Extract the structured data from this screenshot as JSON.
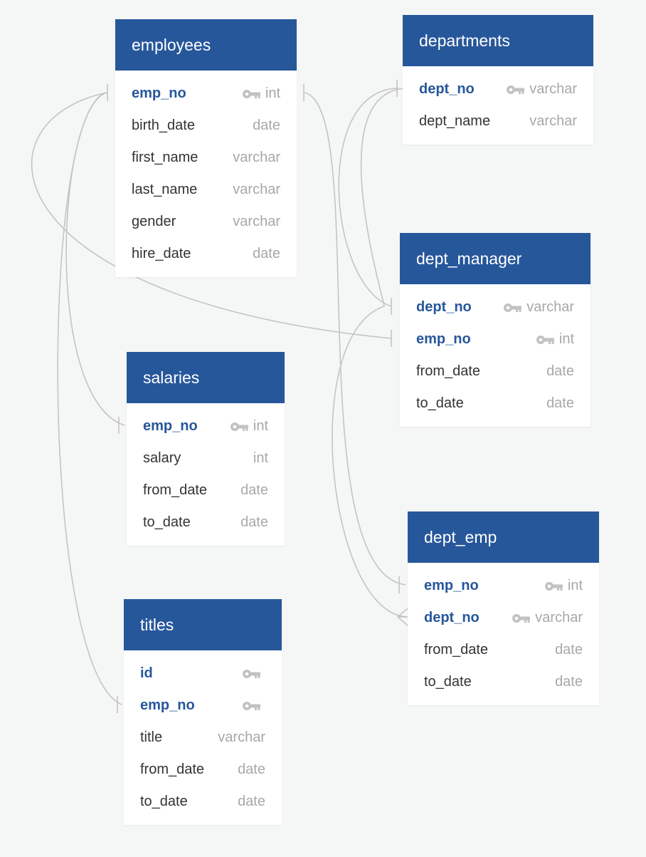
{
  "colors": {
    "header": "#27579b",
    "pk_text": "#27579b",
    "text": "#333333",
    "type_text": "#a8a8a8",
    "connector": "#c4c4c4",
    "background": "#f5f6f6"
  },
  "tables": [
    {
      "id": "employees",
      "name": "employees",
      "columns": [
        {
          "name": "emp_no",
          "type": "int",
          "pk": true
        },
        {
          "name": "birth_date",
          "type": "date",
          "pk": false
        },
        {
          "name": "first_name",
          "type": "varchar",
          "pk": false
        },
        {
          "name": "last_name",
          "type": "varchar",
          "pk": false
        },
        {
          "name": "gender",
          "type": "varchar",
          "pk": false
        },
        {
          "name": "hire_date",
          "type": "date",
          "pk": false
        }
      ]
    },
    {
      "id": "departments",
      "name": "departments",
      "columns": [
        {
          "name": "dept_no",
          "type": "varchar",
          "pk": true
        },
        {
          "name": "dept_name",
          "type": "varchar",
          "pk": false
        }
      ]
    },
    {
      "id": "dept_manager",
      "name": "dept_manager",
      "columns": [
        {
          "name": "dept_no",
          "type": "varchar",
          "pk": true
        },
        {
          "name": "emp_no",
          "type": "int",
          "pk": true
        },
        {
          "name": "from_date",
          "type": "date",
          "pk": false
        },
        {
          "name": "to_date",
          "type": "date",
          "pk": false
        }
      ]
    },
    {
      "id": "salaries",
      "name": "salaries",
      "columns": [
        {
          "name": "emp_no",
          "type": "int",
          "pk": true
        },
        {
          "name": "salary",
          "type": "int",
          "pk": false
        },
        {
          "name": "from_date",
          "type": "date",
          "pk": false
        },
        {
          "name": "to_date",
          "type": "date",
          "pk": false
        }
      ]
    },
    {
      "id": "dept_emp",
      "name": "dept_emp",
      "columns": [
        {
          "name": "emp_no",
          "type": "int",
          "pk": true
        },
        {
          "name": "dept_no",
          "type": "varchar",
          "pk": true
        },
        {
          "name": "from_date",
          "type": "date",
          "pk": false
        },
        {
          "name": "to_date",
          "type": "date",
          "pk": false
        }
      ]
    },
    {
      "id": "titles",
      "name": "titles",
      "columns": [
        {
          "name": "id",
          "type": "",
          "pk": true
        },
        {
          "name": "emp_no",
          "type": "",
          "pk": true
        },
        {
          "name": "title",
          "type": "varchar",
          "pk": false
        },
        {
          "name": "from_date",
          "type": "date",
          "pk": false
        },
        {
          "name": "to_date",
          "type": "date",
          "pk": false
        }
      ]
    }
  ],
  "relationships": [
    {
      "from": "employees.emp_no",
      "to": "dept_manager.emp_no",
      "end": "one"
    },
    {
      "from": "employees.emp_no",
      "to": "salaries.emp_no",
      "end": "one"
    },
    {
      "from": "employees.emp_no",
      "to": "titles.emp_no",
      "end": "one"
    },
    {
      "from": "employees.emp_no",
      "to": "dept_emp.emp_no",
      "end": "one"
    },
    {
      "from": "departments.dept_no",
      "to": "dept_manager.dept_no",
      "end": "one"
    },
    {
      "from": "departments.dept_no",
      "to": "dept_emp.dept_no",
      "end": "many"
    }
  ]
}
